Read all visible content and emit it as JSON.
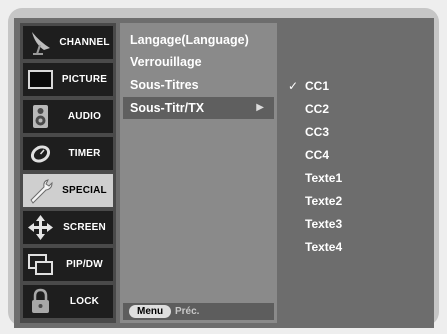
{
  "sidebar": {
    "items": [
      {
        "label": "CHANNEL",
        "icon": "satellite-dish-icon",
        "active": false
      },
      {
        "label": "PICTURE",
        "icon": "tv-screen-icon",
        "active": false
      },
      {
        "label": "AUDIO",
        "icon": "speaker-icon",
        "active": false
      },
      {
        "label": "TIMER",
        "icon": "clock-icon",
        "active": false
      },
      {
        "label": "SPECIAL",
        "icon": "wrench-icon",
        "active": true
      },
      {
        "label": "SCREEN",
        "icon": "move-arrows-icon",
        "active": false
      },
      {
        "label": "PIP/DW",
        "icon": "pip-windows-icon",
        "active": false
      },
      {
        "label": "LOCK",
        "icon": "padlock-icon",
        "active": false
      }
    ]
  },
  "menu": {
    "items": [
      {
        "label": "Langage(Language)",
        "active": false
      },
      {
        "label": "Verrouillage",
        "active": false
      },
      {
        "label": "Sous-Titres",
        "active": false
      },
      {
        "label": "Sous-Titr/TX",
        "active": true,
        "arrow": "▶"
      }
    ],
    "footer": {
      "key": "Menu",
      "action": "Préc."
    }
  },
  "submenu": {
    "items": [
      {
        "label": "CC1",
        "check": "✓"
      },
      {
        "label": "CC2",
        "check": ""
      },
      {
        "label": "CC3",
        "check": ""
      },
      {
        "label": "CC4",
        "check": ""
      },
      {
        "label": "Texte1",
        "check": ""
      },
      {
        "label": "Texte2",
        "check": ""
      },
      {
        "label": "Texte3",
        "check": ""
      },
      {
        "label": "Texte4",
        "check": ""
      }
    ]
  },
  "colors": {
    "background": "#eeeeee",
    "bezel": "#c6c6c6",
    "frame": "#6d6d6d",
    "sidebar": "#4a4a4a",
    "sidebar_item": "#1e1e1e",
    "sidebar_item_active": "#cfcfcf",
    "menu": "#8a8a8a",
    "menu_highlight": "#5f5f5f",
    "text": "#ffffff"
  }
}
